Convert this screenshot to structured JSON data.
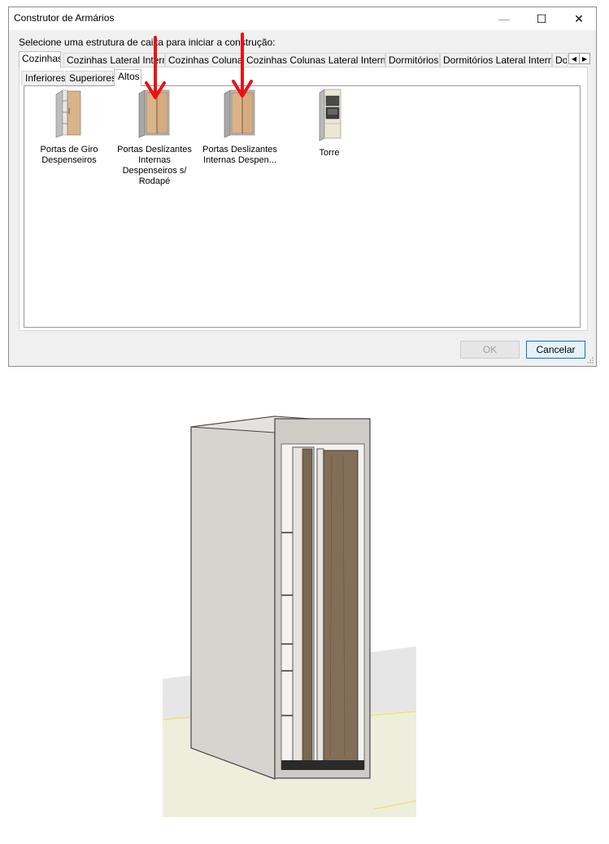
{
  "window": {
    "title": "Construtor de Armários",
    "minimize": "—",
    "maximize": "☐",
    "close": "✕"
  },
  "prompt": "Selecione uma estrutura de caixa para iniciar a construção:",
  "tabs": [
    {
      "label": "Cozinhas",
      "active": true
    },
    {
      "label": "Cozinhas Lateral Interna"
    },
    {
      "label": "Cozinhas Colunas"
    },
    {
      "label": "Cozinhas Colunas Lateral Interna"
    },
    {
      "label": "Dormitórios"
    },
    {
      "label": "Dormitórios Lateral Interna"
    },
    {
      "label": "Dormitórios"
    }
  ],
  "tab_scroll": {
    "left": "◀",
    "right": "▶"
  },
  "subtabs": [
    {
      "label": "Inferiores"
    },
    {
      "label": "Superiores"
    },
    {
      "label": "Altos",
      "active": true
    }
  ],
  "items": [
    {
      "label": "Portas de Giro Despenseiros",
      "icon": "swing-door-cabinet-icon"
    },
    {
      "label": "Portas Deslizantes Internas Despenseiros s/ Rodapé",
      "icon": "sliding-door-cabinet-icon"
    },
    {
      "label": "Portas Deslizantes Internas Despen...",
      "icon": "sliding-door-cabinet-icon"
    },
    {
      "label": "Torre",
      "icon": "tower-cabinet-icon"
    }
  ],
  "buttons": {
    "ok": "OK",
    "cancel": "Cancelar"
  },
  "colors": {
    "arrow": "#ee1111",
    "wood": "#d9b48a",
    "cabinet_gray": "#9a9a9a",
    "accent": "#0078d7"
  }
}
